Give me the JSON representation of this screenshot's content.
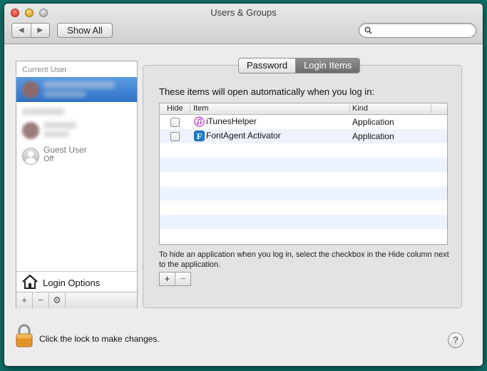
{
  "window": {
    "title": "Users & Groups"
  },
  "toolbar": {
    "back_glyph": "◀",
    "forward_glyph": "▶",
    "show_all_label": "Show All",
    "search_placeholder": ""
  },
  "sidebar": {
    "header": "Current User",
    "guest": {
      "name": "Guest User",
      "status": "Off"
    },
    "login_options_label": "Login Options",
    "bottom_buttons": [
      "+",
      "−",
      "⚙"
    ]
  },
  "tabs": [
    {
      "label": "Password",
      "selected": false
    },
    {
      "label": "Login Items",
      "selected": true
    }
  ],
  "login_items": {
    "description": "These items will open automatically when you log in:",
    "columns": [
      "Hide",
      "Item",
      "Kind"
    ],
    "rows": [
      {
        "hide": false,
        "icon": "itunes-helper-icon",
        "name": "iTunesHelper",
        "kind": "Application"
      },
      {
        "hide": false,
        "icon": "fontagent-icon",
        "name": "FontAgent Activator",
        "kind": "Application"
      }
    ],
    "hint": "To hide an application when you log in, select the checkbox in the Hide column next to the application.",
    "add_label": "+",
    "remove_label": "−"
  },
  "footer": {
    "lock_text": "Click the lock to make changes.",
    "help_label": "?"
  },
  "colors": {
    "selection_blue": "#2f71c9",
    "desktop": "#0f6e67",
    "lock_orange": "#e89a2c"
  }
}
